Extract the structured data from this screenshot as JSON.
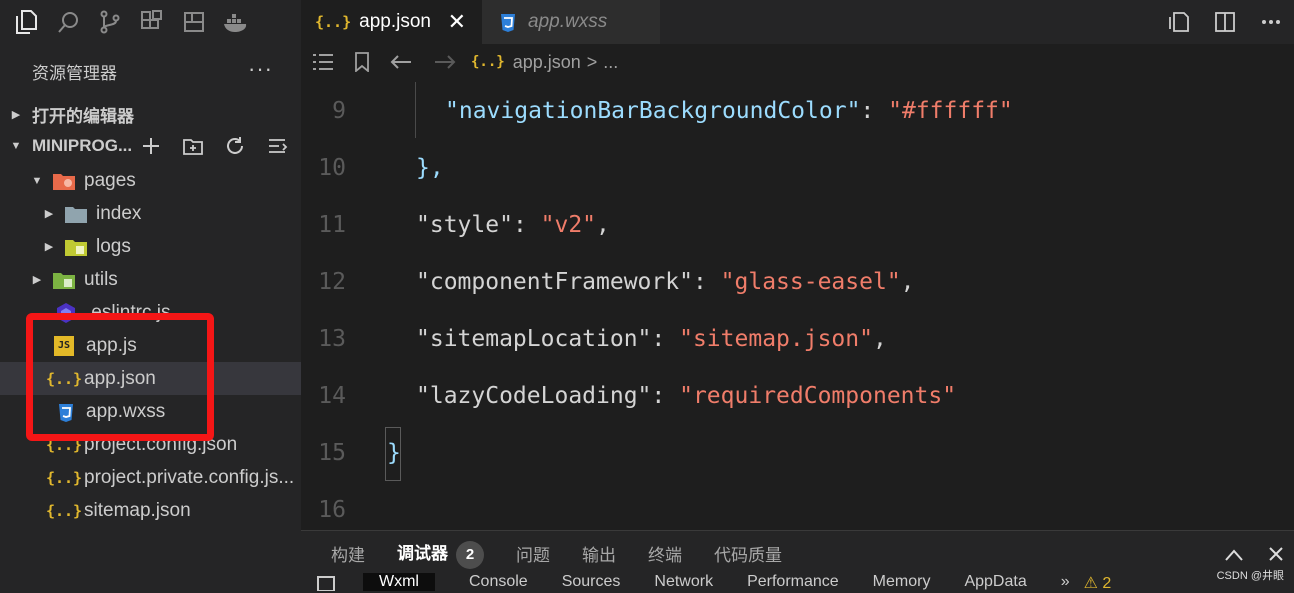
{
  "activity_bar": {
    "icons": [
      "explorer-icon",
      "search-icon",
      "source-control-icon",
      "extensions-icon",
      "layout-icon",
      "docker-icon"
    ]
  },
  "explorer": {
    "title": "资源管理器",
    "more": "···",
    "open_editors": "打开的编辑器",
    "project": "MINIPROG...",
    "tree": [
      {
        "label": "pages",
        "icon": "folder-pages-icon"
      },
      {
        "label": "index",
        "icon": "folder-icon"
      },
      {
        "label": "logs",
        "icon": "folder-logs-icon"
      },
      {
        "label": "utils",
        "icon": "folder-utils-icon"
      },
      {
        "label": ".eslintrc.js",
        "icon": "eslint-icon"
      },
      {
        "label": "app.js",
        "icon": "js-file-icon"
      },
      {
        "label": "app.json",
        "icon": "json-file-icon"
      },
      {
        "label": "app.wxss",
        "icon": "css-file-icon"
      },
      {
        "label": "project.config.json",
        "icon": "json-file-icon"
      },
      {
        "label": "project.private.config.js...",
        "icon": "json-file-icon"
      },
      {
        "label": "sitemap.json",
        "icon": "json-file-icon"
      }
    ]
  },
  "tabs": [
    {
      "label": "app.json",
      "active": true
    },
    {
      "label": "app.wxss",
      "active": false
    }
  ],
  "breadcrumb": {
    "file": "app.json",
    "sep": ">",
    "rest": "..."
  },
  "code": {
    "lines": [
      {
        "num": "9",
        "key": "\"navigationBarBackgroundColor\"",
        "colon": ": ",
        "val": "\"#ffffff\"",
        "tail": ""
      },
      {
        "num": "10",
        "punct": "},"
      },
      {
        "num": "11",
        "key": "\"style\"",
        "colon": ": ",
        "val": "\"v2\"",
        "tail": ","
      },
      {
        "num": "12",
        "key": "\"componentFramework\"",
        "colon": ": ",
        "val": "\"glass-easel\"",
        "tail": ","
      },
      {
        "num": "13",
        "key": "\"sitemapLocation\"",
        "colon": ": ",
        "val": "\"sitemap.json\"",
        "tail": ","
      },
      {
        "num": "14",
        "key": "\"lazyCodeLoading\"",
        "colon": ": ",
        "val": "\"requiredComponents\"",
        "tail": ""
      },
      {
        "num": "15",
        "punct": "}"
      },
      {
        "num": "16",
        "punct": ""
      }
    ]
  },
  "panel": {
    "tabs": [
      "构建",
      "调试器",
      "问题",
      "输出",
      "终端",
      "代码质量"
    ],
    "debugger_badge": "2",
    "devtools_tabs": [
      "Wxml",
      "Console",
      "Sources",
      "Network",
      "Performance",
      "Memory",
      "AppData",
      "»",
      "⚠ 2"
    ]
  },
  "watermark": "CSDN @井眼",
  "colors": {
    "highlight": "#f41616",
    "json_key": "#9cdcfe",
    "json_string": "#f07d6a"
  }
}
